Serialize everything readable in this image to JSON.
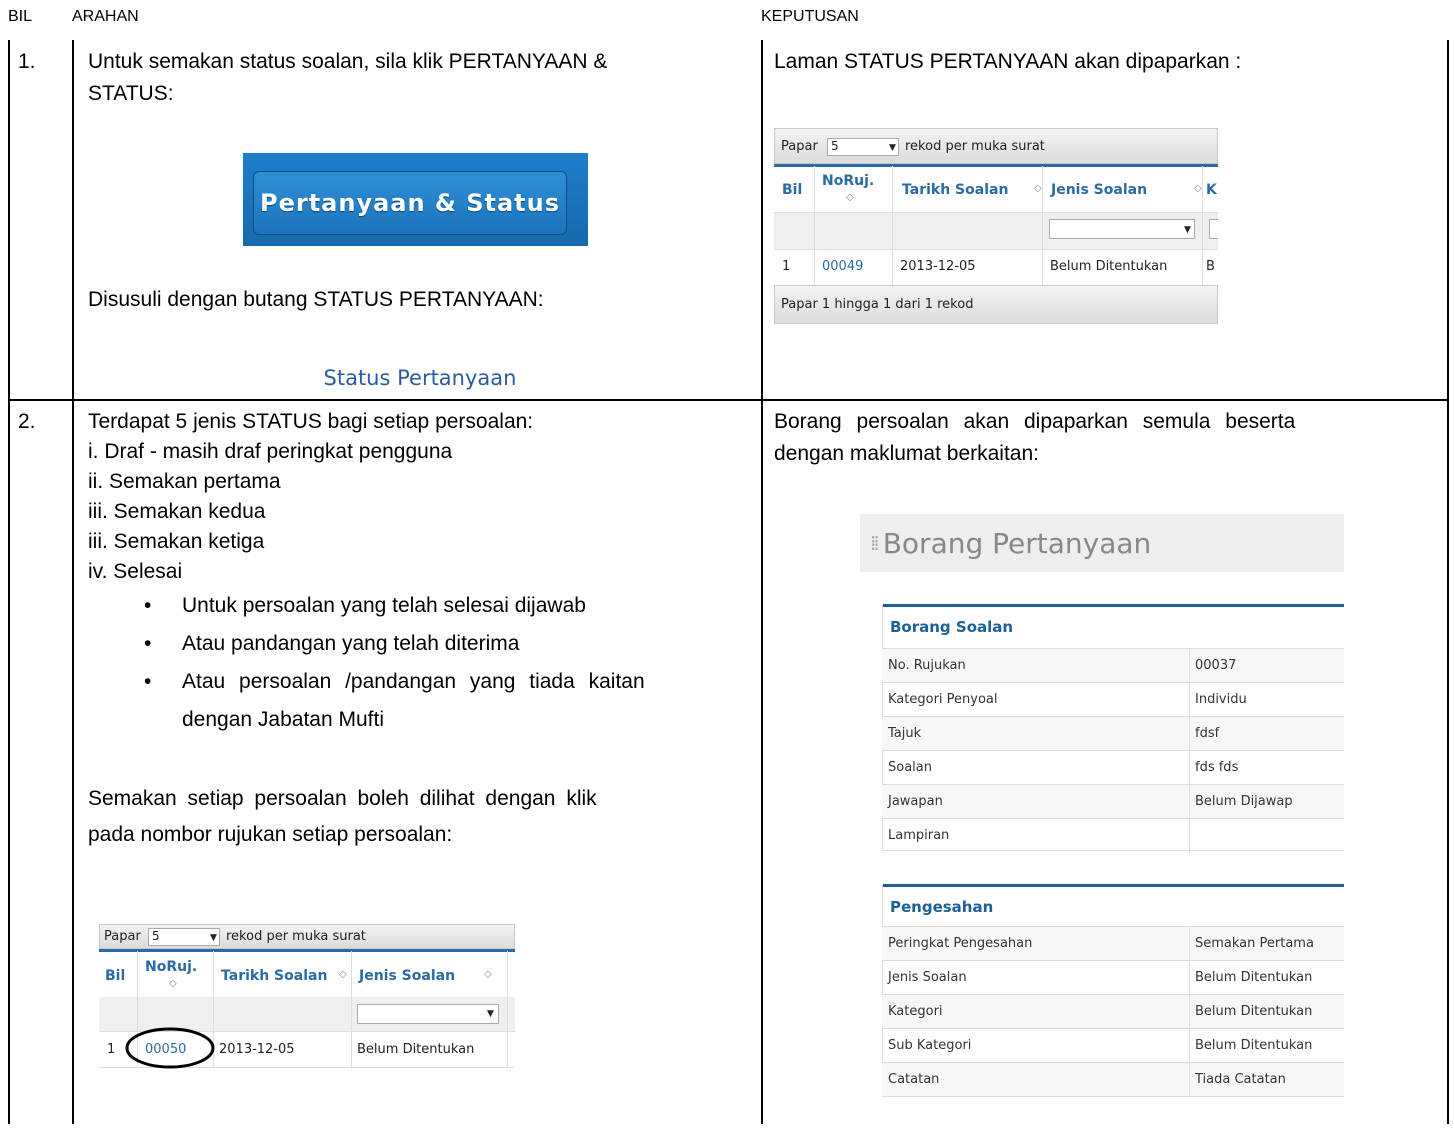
{
  "header": {
    "bil": "BIL",
    "arahan": "ARAHAN",
    "keputusan": "KEPUTUSAN"
  },
  "row1": {
    "bil": "1.",
    "arahan_line1": "Untuk semakan status soalan, sila klik PERTANYAAN &",
    "arahan_line2": "STATUS:",
    "button_label": "Pertanyaan & Status",
    "followup_text": "Disusuli dengan butang STATUS PERTANYAAN:",
    "status_link": "Status Pertanyaan",
    "keputusan_text": "Laman STATUS PERTANYAAN akan dipaparkan :",
    "table": {
      "show_prefix": "Papar",
      "show_value": "5",
      "show_suffix": "rekod per muka surat",
      "columns": [
        "Bil",
        "NoRuj.",
        "Tarikh Soalan",
        "Jenis Soalan",
        "K"
      ],
      "row": [
        "1",
        "00049",
        "2013-12-05",
        "Belum Ditentukan",
        "B"
      ],
      "footer": "Papar 1 hingga 1 dari 1 rekod"
    }
  },
  "row2": {
    "bil": "2.",
    "intro": "Terdapat 5 jenis STATUS bagi setiap persoalan:",
    "statuses": [
      "i. Draf - masih draf peringkat pengguna",
      "ii. Semakan pertama",
      "iii. Semakan kedua",
      "iii. Semakan ketiga",
      "iv. Selesai"
    ],
    "bullets": [
      "Untuk persoalan yang telah selesai dijawab",
      "Atau pandangan yang telah diterima",
      "Atau persoalan /pandangan yang tiada kaitan",
      "dengan Jabatan Mufti"
    ],
    "semakan_line1": "Semakan setiap persoalan boleh dilihat dengan klik",
    "semakan_line2": "pada nombor rujukan setiap persoalan:",
    "table": {
      "show_prefix": "Papar",
      "show_value": "5",
      "show_suffix": "rekod per muka surat",
      "columns": [
        "Bil",
        "NoRuj.",
        "Tarikh Soalan",
        "Jenis Soalan"
      ],
      "row": [
        "1",
        "00050",
        "2013-12-05",
        "Belum Ditentukan"
      ]
    },
    "keputusan_line1": "Borang persoalan akan dipaparkan semula beserta",
    "keputusan_line2": "dengan maklumat berkaitan:",
    "panel_title": "Borang Pertanyaan",
    "borang_soalan": {
      "title": "Borang Soalan",
      "rows": [
        {
          "label": "No. Rujukan",
          "value": "00037"
        },
        {
          "label": "Kategori Penyoal",
          "value": "Individu"
        },
        {
          "label": "Tajuk",
          "value": "fdsf"
        },
        {
          "label": "Soalan",
          "value": "fds fds"
        },
        {
          "label": "Jawapan",
          "value": "Belum Dijawap"
        },
        {
          "label": "Lampiran",
          "value": ""
        }
      ]
    },
    "pengesahan": {
      "title": "Pengesahan",
      "rows": [
        {
          "label": "Peringkat Pengesahan",
          "value": "Semakan Pertama"
        },
        {
          "label": "Jenis Soalan",
          "value": "Belum Ditentukan"
        },
        {
          "label": "Kategori",
          "value": "Belum Ditentukan"
        },
        {
          "label": "Sub Kategori",
          "value": "Belum Ditentukan"
        },
        {
          "label": "Catatan",
          "value": "Tiada Catatan"
        }
      ]
    }
  }
}
